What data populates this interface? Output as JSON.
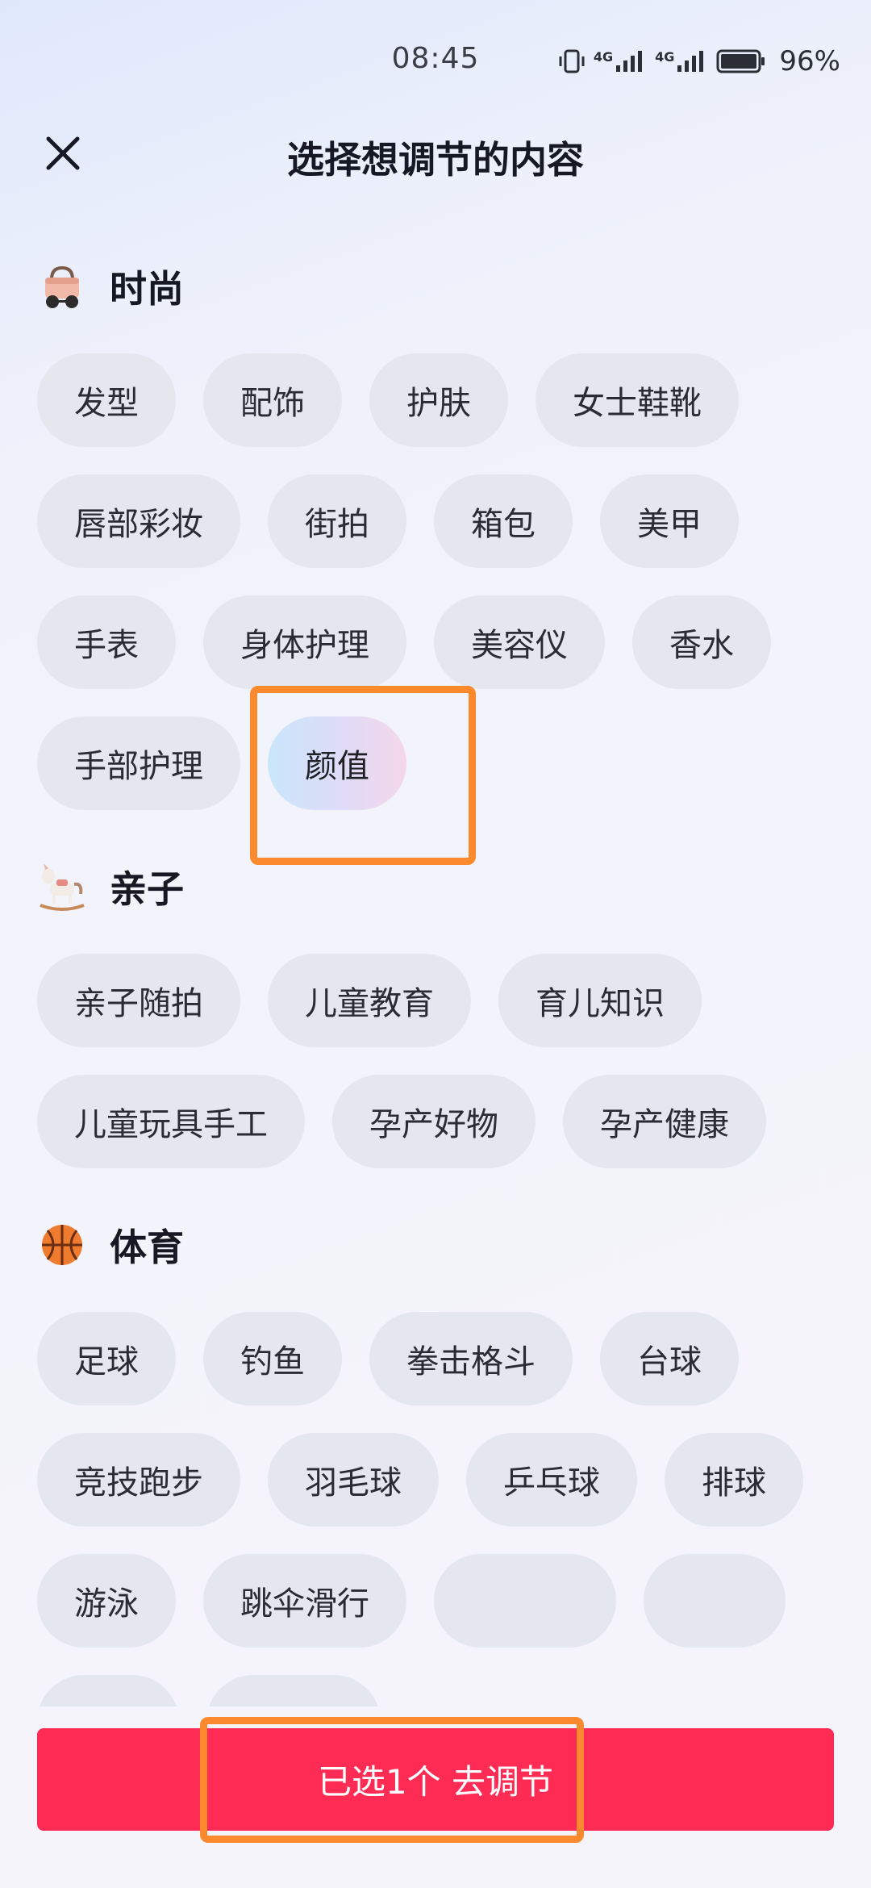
{
  "status_bar": {
    "time": "08:45",
    "battery": "96%",
    "network_1": "4G",
    "network_2": "4G"
  },
  "header": {
    "title": "选择想调节的内容",
    "close_icon": "close-icon"
  },
  "categories": [
    {
      "title": "时尚",
      "icon": "handbag-sunglasses-emoji",
      "tags": [
        "发型",
        "配饰",
        "护肤",
        "女士鞋靴",
        "唇部彩妆",
        "街拍",
        "箱包",
        "美甲",
        "手表",
        "身体护理",
        "美容仪",
        "香水",
        "手部护理",
        "颜值"
      ]
    },
    {
      "title": "亲子",
      "icon": "rocking-horse-emoji",
      "tags": [
        "亲子随拍",
        "儿童教育",
        "育儿知识",
        "儿童玩具手工",
        "孕产好物",
        "孕产健康"
      ]
    },
    {
      "title": "体育",
      "icon": "basketball-emoji",
      "tags": [
        "足球",
        "钓鱼",
        "拳击格斗",
        "台球",
        "竞技跑步",
        "羽毛球",
        "乒乓球",
        "排球",
        "游泳",
        "跳伞滑行"
      ]
    }
  ],
  "selected_tag": "颜值",
  "bottom": {
    "confirm_label": "已选1个 去调节"
  },
  "colors": {
    "accent": "#fe2c55",
    "highlight": "#fb8a2e",
    "chip_bg": "#e5e7ef"
  }
}
